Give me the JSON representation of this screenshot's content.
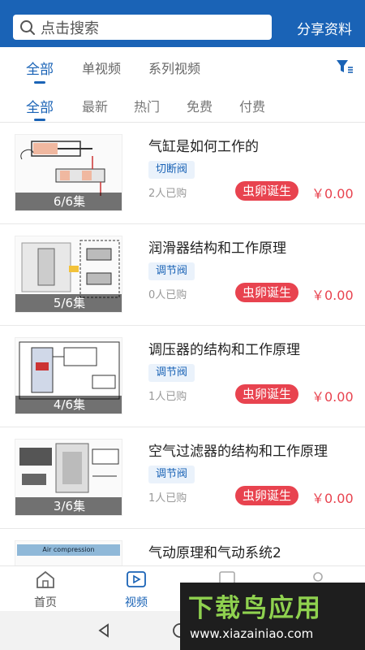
{
  "header": {
    "search_placeholder": "点击搜索",
    "share_label": "分享资料"
  },
  "tabs_primary": [
    "全部",
    "单视频",
    "系列视频"
  ],
  "tabs_secondary": [
    "全部",
    "最新",
    "热门",
    "免费",
    "付费"
  ],
  "items": [
    {
      "title": "气缸是如何工作的",
      "tag": "切断阀",
      "bought": "2人已购",
      "author": "虫卵诞生",
      "price": "￥0.00",
      "episodes": "6/6集"
    },
    {
      "title": "润滑器结构和工作原理",
      "tag": "调节阀",
      "bought": "0人已购",
      "author": "虫卵诞生",
      "price": "￥0.00",
      "episodes": "5/6集"
    },
    {
      "title": "调压器的结构和工作原理",
      "tag": "调节阀",
      "bought": "1人已购",
      "author": "虫卵诞生",
      "price": "￥0.00",
      "episodes": "4/6集"
    },
    {
      "title": "空气过滤器的结构和工作原理",
      "tag": "调节阀",
      "bought": "1人已购",
      "author": "虫卵诞生",
      "price": "￥0.00",
      "episodes": "3/6集"
    },
    {
      "title": "气动原理和气动系统2",
      "thumb_text": "Air compression"
    }
  ],
  "bottom_nav": [
    "首页",
    "视频"
  ],
  "watermark": {
    "brand": "下载鸟应用",
    "url": "www.xiazainiao.com"
  },
  "colors": {
    "primary": "#1a63b6",
    "accent_red": "#e8434f",
    "tag_bg": "#eaf2fb"
  }
}
